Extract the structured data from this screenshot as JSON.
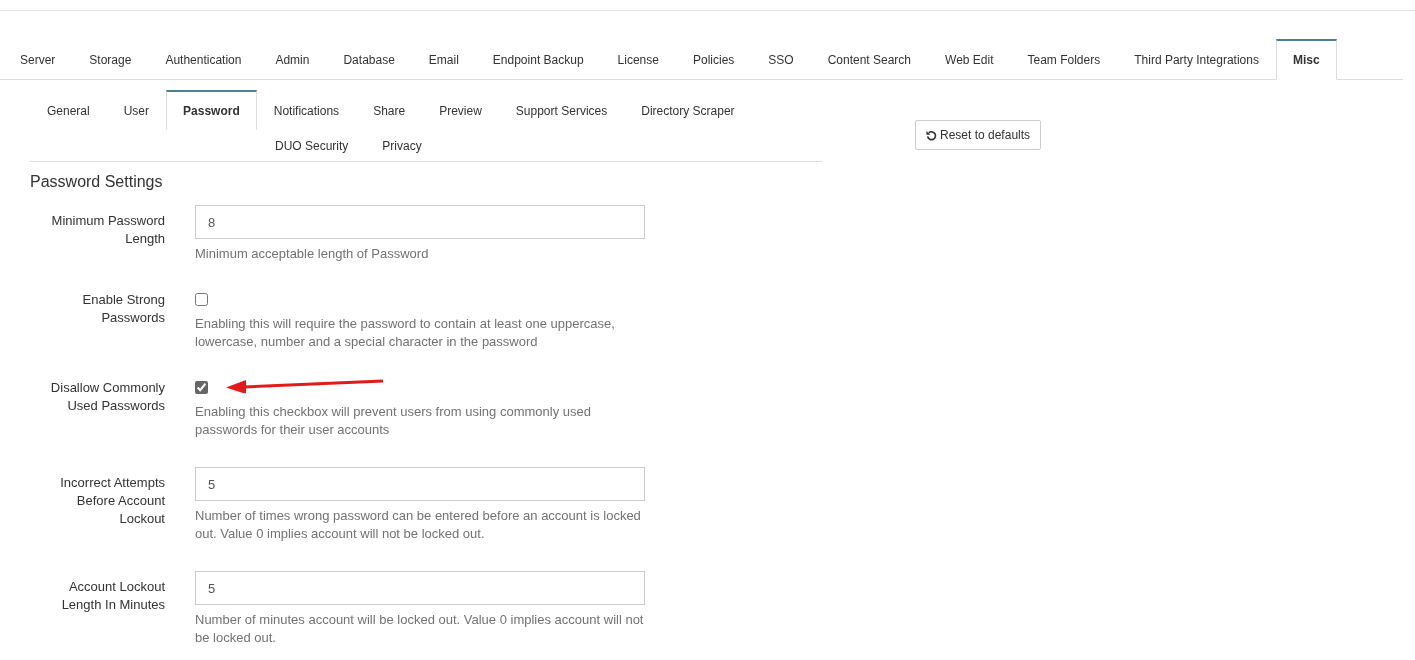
{
  "main_tabs": [
    {
      "label": "Server",
      "selected": false
    },
    {
      "label": "Storage",
      "selected": false
    },
    {
      "label": "Authentication",
      "selected": false
    },
    {
      "label": "Admin",
      "selected": false
    },
    {
      "label": "Database",
      "selected": false
    },
    {
      "label": "Email",
      "selected": false
    },
    {
      "label": "Endpoint Backup",
      "selected": false
    },
    {
      "label": "License",
      "selected": false
    },
    {
      "label": "Policies",
      "selected": false
    },
    {
      "label": "SSO",
      "selected": false
    },
    {
      "label": "Content Search",
      "selected": false
    },
    {
      "label": "Web Edit",
      "selected": false
    },
    {
      "label": "Team Folders",
      "selected": false
    },
    {
      "label": "Third Party Integrations",
      "selected": false
    },
    {
      "label": "Misc",
      "selected": true
    }
  ],
  "sub_tab_rows": [
    [
      {
        "label": "General",
        "selected": false
      },
      {
        "label": "User",
        "selected": false
      },
      {
        "label": "Password",
        "selected": true
      },
      {
        "label": "Notifications",
        "selected": false
      },
      {
        "label": "Share",
        "selected": false
      },
      {
        "label": "Preview",
        "selected": false
      },
      {
        "label": "Support Services",
        "selected": false
      },
      {
        "label": "Directory Scraper",
        "selected": false
      }
    ],
    [
      {
        "label": "DUO Security",
        "selected": false
      },
      {
        "label": "Privacy",
        "selected": false
      }
    ]
  ],
  "reset_button": "Reset to defaults",
  "section_title": "Password Settings",
  "fields": [
    {
      "kind": "text",
      "label": "Minimum Password Length",
      "value": "8",
      "help": "Minimum acceptable length of Password"
    },
    {
      "kind": "checkbox",
      "label": "Enable Strong Passwords",
      "checked": false,
      "help": "Enabling this will require the password to contain at least one uppercase, lowercase, number and a special character in the password"
    },
    {
      "kind": "checkbox",
      "label": "Disallow Commonly Used Passwords",
      "checked": true,
      "help": "Enabling this checkbox will prevent users from using commonly used passwords for their user accounts"
    },
    {
      "kind": "text",
      "label": "Incorrect Attempts Before Account Lockout",
      "value": "5",
      "help": "Number of times wrong password can be entered before an account is locked out. Value 0 implies account will not be locked out."
    },
    {
      "kind": "text",
      "label": "Account Lockout Length In Minutes",
      "value": "5",
      "help": "Number of minutes account will be locked out. Value 0 implies account will not be locked out."
    }
  ]
}
